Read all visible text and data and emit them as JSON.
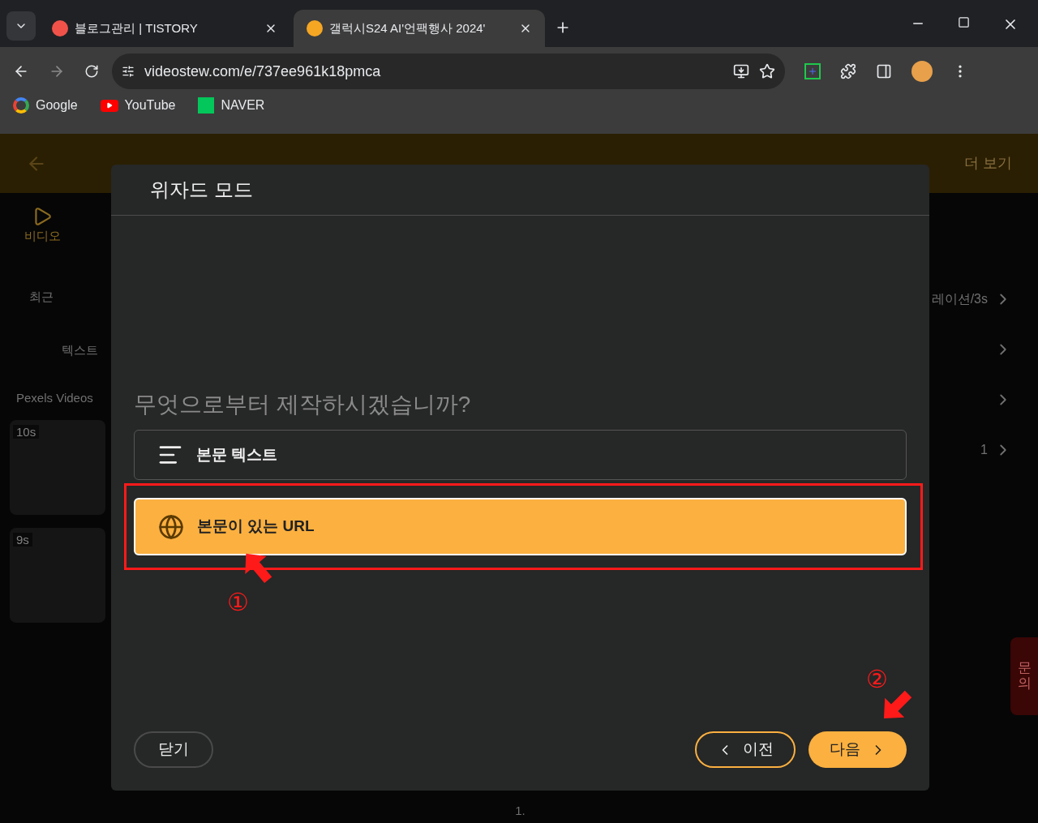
{
  "browser": {
    "tabs": [
      {
        "title": "블로그관리 | TISTORY",
        "selected": false
      },
      {
        "title": "갤럭시S24 AI'언팩행사 2024'",
        "selected": true
      }
    ],
    "url": "videostew.com/e/737ee961k18pmca",
    "bookmarks": [
      "Google",
      "YouTube",
      "NAVER"
    ]
  },
  "app_header": {
    "more": "더 보기"
  },
  "sidebar": {
    "tab": "비디오",
    "filters": [
      "최근",
      "텍스트"
    ],
    "source": "Pexels Videos",
    "clips": [
      {
        "duration": "10s"
      },
      {
        "duration": "9s"
      }
    ]
  },
  "right_panel": {
    "rows": [
      "레이션/3s",
      "",
      "",
      "1"
    ],
    "help": "문의"
  },
  "page_number": "1.",
  "dialog": {
    "title": "위자드 모드",
    "question": "무엇으로부터 제작하시겠습니까?",
    "options": [
      {
        "label": "본문 텍스트",
        "selected": false
      },
      {
        "label": "본문이 있는 URL",
        "selected": true
      }
    ],
    "close": "닫기",
    "prev": "이전",
    "next": "다음"
  },
  "markers": [
    "①",
    "②"
  ]
}
